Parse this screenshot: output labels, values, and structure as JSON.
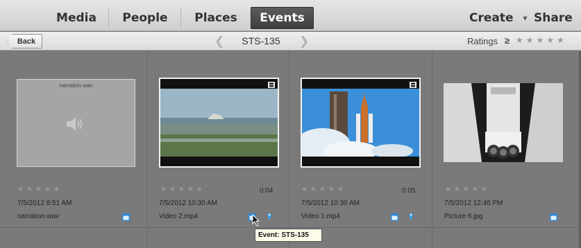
{
  "tabs": [
    {
      "label": "Media"
    },
    {
      "label": "People"
    },
    {
      "label": "Places"
    },
    {
      "label": "Events"
    }
  ],
  "menus": {
    "create": "Create",
    "share": "Share"
  },
  "subbar": {
    "back": "Back",
    "event_title": "STS-135",
    "ratings_label": "Ratings",
    "ratings_ge": "≥",
    "ratings_stars": "★★★★★"
  },
  "items": [
    {
      "type": "audio",
      "thumb_caption": "narration.wav",
      "stars": "★★★★★",
      "duration": "",
      "datetime": "7/5/2012 8:51 AM",
      "filename": "narration.wav"
    },
    {
      "type": "video",
      "stars": "★★★★★",
      "duration": "0:04",
      "datetime": "7/5/2012 10:30 AM",
      "filename": "Video 2.mp4"
    },
    {
      "type": "video",
      "stars": "★★★★★",
      "duration": "0:05",
      "datetime": "7/5/2012 10:30 AM",
      "filename": "Video 1.mp4"
    },
    {
      "type": "photo",
      "stars": "★★★★★",
      "duration": "",
      "datetime": "7/5/2012 12:46 PM",
      "filename": "Picture 6.jpg"
    }
  ],
  "tooltip": "Event: STS-135",
  "colors": {
    "active_tab": "#4a4a4a",
    "grid_bg": "#7a7a7a",
    "badge_blue": "#2f86d6",
    "tooltip_bg": "#fbfbe8"
  }
}
